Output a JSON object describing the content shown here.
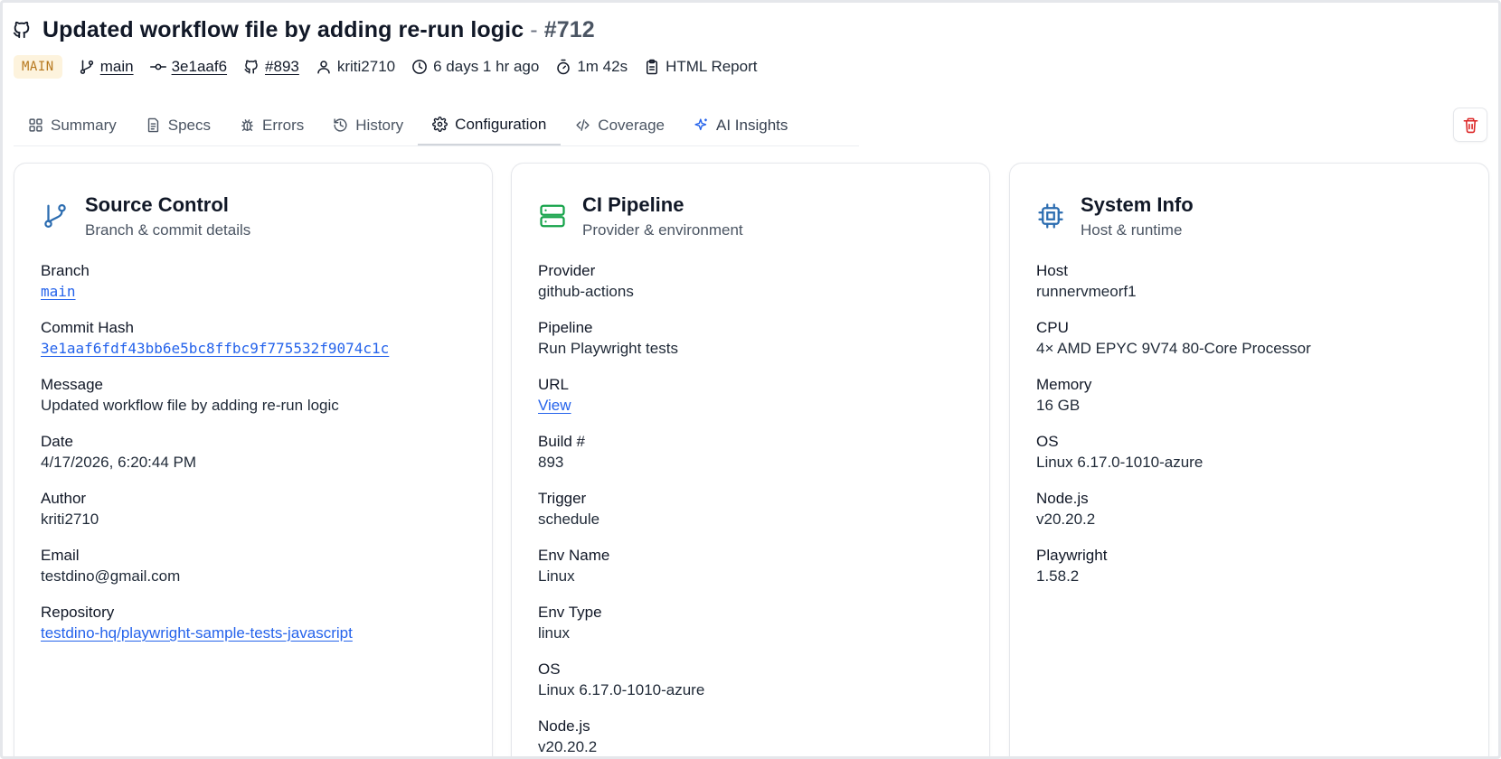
{
  "header": {
    "title": "Updated workflow file by adding re-run logic",
    "title_separator": "-",
    "run_number": "#712"
  },
  "meta": {
    "badge": "MAIN",
    "branch": "main",
    "commit": "3e1aaf6",
    "build": "#893",
    "author": "kriti2710",
    "time_ago": "6 days 1 hr ago",
    "duration": "1m 42s",
    "report": "HTML Report"
  },
  "tabs": [
    {
      "label": "Summary",
      "icon": "grid-icon"
    },
    {
      "label": "Specs",
      "icon": "file-text-icon"
    },
    {
      "label": "Errors",
      "icon": "bug-icon"
    },
    {
      "label": "History",
      "icon": "history-icon"
    },
    {
      "label": "Configuration",
      "icon": "gear-icon"
    },
    {
      "label": "Coverage",
      "icon": "code-icon"
    },
    {
      "label": "AI Insights",
      "icon": "sparkles-icon"
    }
  ],
  "active_tab": "Configuration",
  "source_control": {
    "title": "Source Control",
    "subtitle": "Branch & commit details",
    "fields": [
      {
        "label": "Branch",
        "value": "main"
      },
      {
        "label": "Commit Hash",
        "value": "3e1aaf6fdf43bb6e5bc8ffbc9f775532f9074c1c"
      },
      {
        "label": "Message",
        "value": "Updated workflow file by adding re-run logic"
      },
      {
        "label": "Date",
        "value": "4/17/2026, 6:20:44 PM"
      },
      {
        "label": "Author",
        "value": "kriti2710"
      },
      {
        "label": "Email",
        "value": "testdino@gmail.com"
      },
      {
        "label": "Repository",
        "value": "testdino-hq/playwright-sample-tests-javascript"
      }
    ]
  },
  "ci_pipeline": {
    "title": "CI Pipeline",
    "subtitle": "Provider & environment",
    "fields": [
      {
        "label": "Provider",
        "value": "github-actions"
      },
      {
        "label": "Pipeline",
        "value": "Run Playwright tests"
      },
      {
        "label": "URL",
        "value": "View"
      },
      {
        "label": "Build #",
        "value": "893"
      },
      {
        "label": "Trigger",
        "value": "schedule"
      },
      {
        "label": "Env Name",
        "value": "Linux"
      },
      {
        "label": "Env Type",
        "value": "linux"
      },
      {
        "label": "OS",
        "value": "Linux 6.17.0-1010-azure"
      },
      {
        "label": "Node.js",
        "value": "v20.20.2"
      }
    ]
  },
  "system_info": {
    "title": "System Info",
    "subtitle": "Host & runtime",
    "fields": [
      {
        "label": "Host",
        "value": "runnervmeorf1"
      },
      {
        "label": "CPU",
        "value": "4× AMD EPYC 9V74 80-Core Processor"
      },
      {
        "label": "Memory",
        "value": "16 GB"
      },
      {
        "label": "OS",
        "value": "Linux 6.17.0-1010-azure"
      },
      {
        "label": "Node.js",
        "value": "v20.20.2"
      },
      {
        "label": "Playwright",
        "value": "1.58.2"
      }
    ]
  },
  "colors": {
    "accent_link": "#2563eb",
    "badge_bg": "#fdf3dd",
    "badge_text": "#b7791f",
    "source_icon": "#2b6cb0",
    "ci_icon": "#16a34a",
    "system_icon": "#2b6cb0",
    "delete_icon": "#dc2626"
  }
}
